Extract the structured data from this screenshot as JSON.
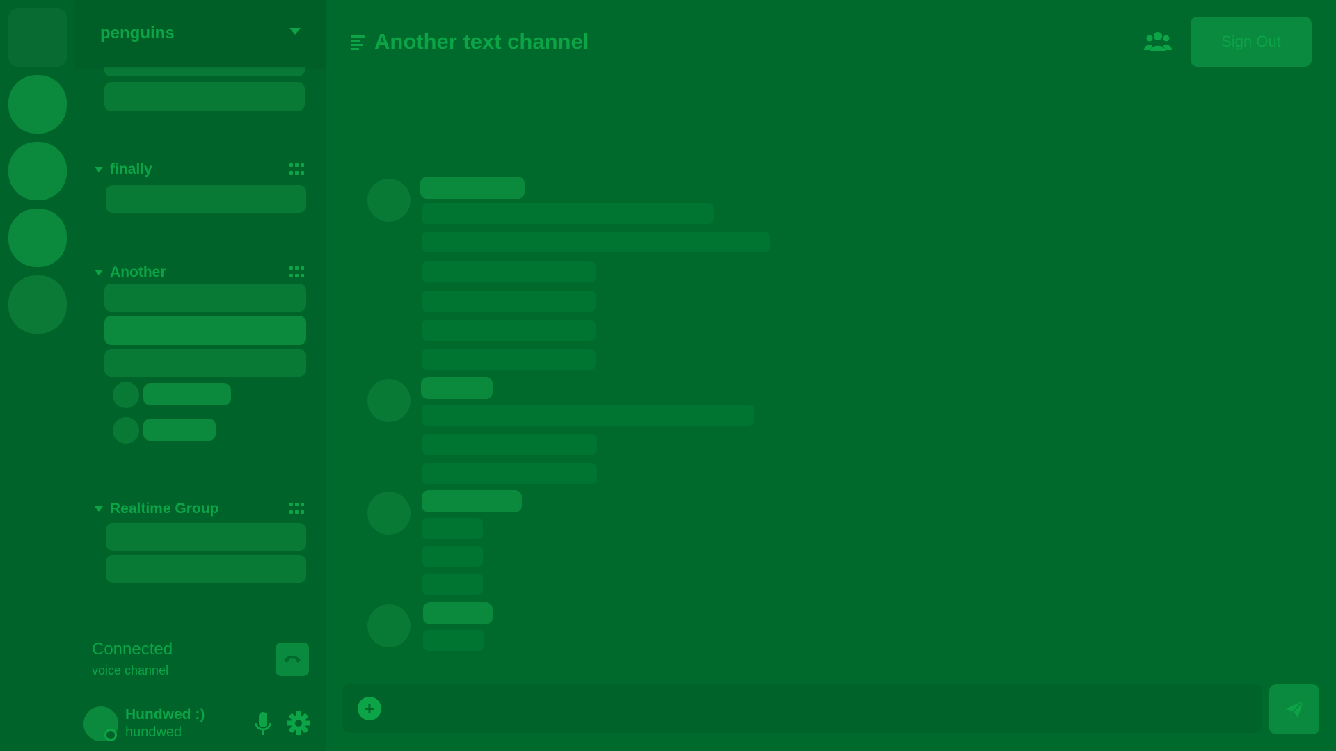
{
  "server": {
    "name": "penguins"
  },
  "categories": [
    {
      "label": "finally"
    },
    {
      "label": "Another"
    },
    {
      "label": "Realtime Group"
    }
  ],
  "voice": {
    "status": "Connected",
    "channel": "voice channel"
  },
  "user": {
    "display_name": "Hundwed :)",
    "username": "hundwed"
  },
  "channel": {
    "title": "Another text channel"
  },
  "header": {
    "signout_label": "Sign Out"
  },
  "composer": {
    "placeholder": "",
    "plus_icon": "+"
  },
  "icons": {
    "server_chevron": "chevron-down-icon",
    "category_grid": "grid-icon",
    "hangup": "phone-hangup-icon",
    "mic": "microphone-icon",
    "settings": "gear-icon",
    "channel": "text-channel-icon",
    "members": "members-icon",
    "send": "send-icon"
  },
  "colors": {
    "background": "#006a2c",
    "sidebar": "#00642a",
    "accent": "#0ca447",
    "skeleton": "#0b8a3e"
  }
}
